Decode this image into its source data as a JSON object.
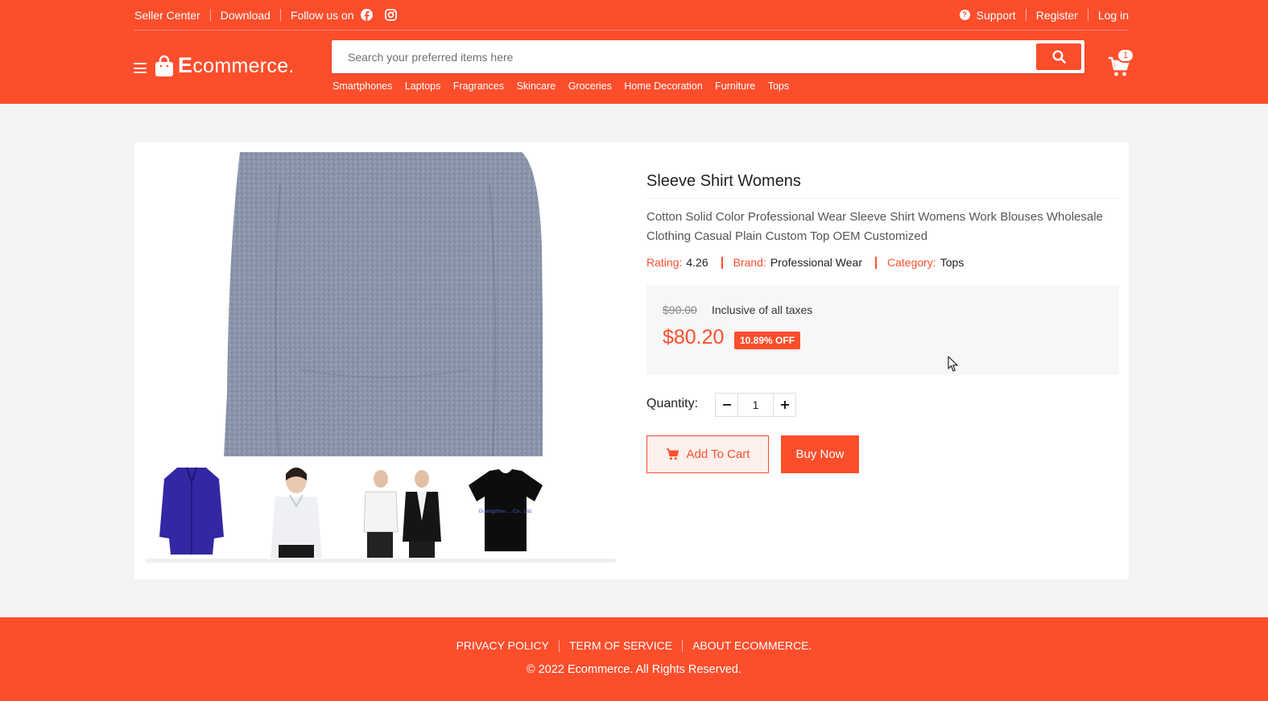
{
  "header": {
    "topbar": {
      "seller_center": "Seller Center",
      "download": "Download",
      "follow_us": "Follow us on",
      "support": "Support",
      "register": "Register",
      "login": "Log in"
    },
    "logo_text_first": "E",
    "logo_text_rest": "commerce.",
    "search_placeholder": "Search your preferred items here",
    "categories": [
      "Smartphones",
      "Laptops",
      "Fragrances",
      "Skincare",
      "Groceries",
      "Home Decoration",
      "Furniture",
      "Tops"
    ],
    "cart_count": "1"
  },
  "product": {
    "title": "Sleeve Shirt Womens",
    "description": "Cotton Solid Color Professional Wear Sleeve Shirt Womens Work Blouses Wholesale Clothing Casual Plain Custom Top OEM Customized",
    "rating_label": "Rating:",
    "rating": "4.26",
    "brand_label": "Brand:",
    "brand": "Professional Wear",
    "category_label": "Category:",
    "category": "Tops",
    "old_price": "$90.00",
    "tax_note": "Inclusive of all taxes",
    "price": "$80.20",
    "discount": "10.89% OFF",
    "quantity_label": "Quantity:",
    "quantity": "1",
    "add_to_cart": "Add To Cart",
    "buy_now": "Buy Now",
    "thumb_caption": "Guangzhou ... Co., Ltd."
  },
  "footer": {
    "privacy": "PRIVACY POLICY",
    "terms": "TERM OF SERVICE",
    "about": "ABOUT ECOMMERCE.",
    "copyright": "© 2022 Ecommerce. All Rights Reserved."
  },
  "colors": {
    "brand": "#fd4e2c",
    "background": "#f4f4f4"
  }
}
